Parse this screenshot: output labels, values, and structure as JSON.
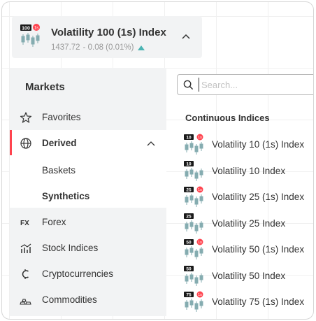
{
  "selector": {
    "title": "Volatility 100 (1s) Index",
    "price": "1437.72",
    "change": "- 0.08 (0.01%)",
    "icon_badge_num": "100",
    "icon_badge_speed": "1s",
    "trend": "up",
    "trend_color": "#4bb4b3"
  },
  "left_panel": {
    "title": "Markets",
    "items": [
      {
        "label": "Favorites",
        "icon": "star-icon"
      },
      {
        "label": "Derived",
        "icon": "globe-icon",
        "expanded": true
      },
      {
        "label": "Forex",
        "icon": "forex-icon"
      },
      {
        "label": "Stock Indices",
        "icon": "stock-indices-icon"
      },
      {
        "label": "Cryptocurrencies",
        "icon": "crypto-icon"
      },
      {
        "label": "Commodities",
        "icon": "commodities-icon"
      }
    ],
    "sub_items": [
      {
        "label": "Baskets"
      },
      {
        "label": "Synthetics",
        "selected": true
      }
    ],
    "accent_color": "#ff444f"
  },
  "search": {
    "placeholder": "Search..."
  },
  "market_list": {
    "title": "Continuous Indices",
    "items": [
      {
        "label": "Volatility 10 (1s) Index",
        "badge": "10",
        "speed": "1s"
      },
      {
        "label": "Volatility 10 Index",
        "badge": "10",
        "speed": ""
      },
      {
        "label": "Volatility 25 (1s) Index",
        "badge": "25",
        "speed": "1s"
      },
      {
        "label": "Volatility 25 Index",
        "badge": "25",
        "speed": ""
      },
      {
        "label": "Volatility 50 (1s) Index",
        "badge": "50",
        "speed": "1s"
      },
      {
        "label": "Volatility 50 Index",
        "badge": "50",
        "speed": ""
      },
      {
        "label": "Volatility 75 (1s) Index",
        "badge": "75",
        "speed": "1s"
      }
    ]
  }
}
